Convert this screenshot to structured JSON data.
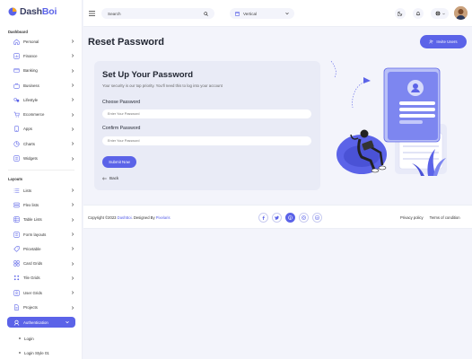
{
  "app": {
    "logo_part1": "Dash",
    "logo_part2": "Boi",
    "accent": "#5b63e8"
  },
  "sidebar": {
    "section_dashboard": "Dashboard",
    "dashboard_items": [
      {
        "label": "Personal",
        "icon": "home-icon"
      },
      {
        "label": "Finance",
        "icon": "chart-icon"
      },
      {
        "label": "Banking",
        "icon": "card-icon"
      },
      {
        "label": "Business",
        "icon": "briefcase-icon"
      },
      {
        "label": "Lifestyle",
        "icon": "lifestyle-icon"
      },
      {
        "label": "Ecommerce",
        "icon": "cart-icon"
      },
      {
        "label": "Apps",
        "icon": "apps-icon"
      },
      {
        "label": "Charts",
        "icon": "pie-chart-icon"
      },
      {
        "label": "Widgets",
        "icon": "widgets-icon"
      }
    ],
    "section_layouts": "Layouts",
    "layout_items": [
      {
        "label": "Lists",
        "icon": "list-icon"
      },
      {
        "label": "Flex lists",
        "icon": "flex-list-icon"
      },
      {
        "label": "Table Lists",
        "icon": "table-icon"
      },
      {
        "label": "Form layouts",
        "icon": "form-icon"
      },
      {
        "label": "Pricetable",
        "icon": "price-icon"
      },
      {
        "label": "Card Grids",
        "icon": "card-grid-icon"
      },
      {
        "label": "Tile Grids",
        "icon": "tile-grid-icon"
      },
      {
        "label": "User Grids",
        "icon": "user-grid-icon"
      },
      {
        "label": "Projects",
        "icon": "projects-icon"
      }
    ],
    "active_item": {
      "label": "Authentication",
      "icon": "auth-icon"
    },
    "sub_items": [
      "Login",
      "Login Style 01"
    ]
  },
  "topbar": {
    "search_placeholder": "Search",
    "layout_value": "Vertical"
  },
  "page": {
    "title": "Reset Password",
    "invite_label": "Invite Users"
  },
  "form": {
    "title": "Set Up Your Password",
    "subtitle": "Your security is our top priority. You'll need this to log into your account",
    "choose_label": "Choose Password",
    "choose_placeholder": "Enter Your Password",
    "confirm_label": "Confirm Password",
    "confirm_placeholder": "Enter Your Password",
    "submit_label": "Submit Now",
    "back_label": "Back"
  },
  "footer": {
    "copyright_prefix": "Copyright ©2023",
    "brand_link": "DashBoi",
    "designed_by": "Designed By",
    "designer_link": "Pixelaris",
    "privacy": "Privacy policy",
    "terms": "Terms of condition",
    "social_icons": [
      "facebook-icon",
      "twitter-icon",
      "pinterest-icon",
      "instagram-icon",
      "linkedin-icon"
    ]
  }
}
